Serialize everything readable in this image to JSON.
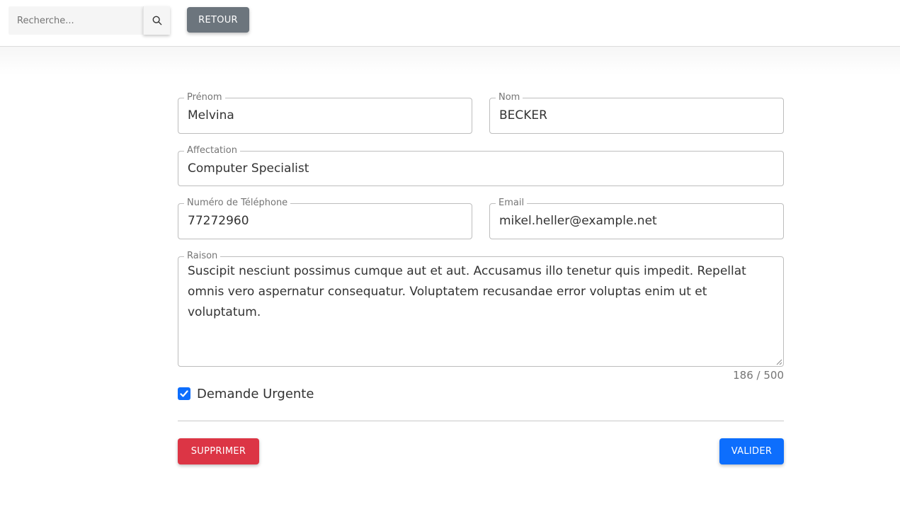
{
  "search": {
    "placeholder": "Recherche..."
  },
  "header": {
    "back_label": "RETOUR"
  },
  "form": {
    "first_name": {
      "label": "Prénom",
      "value": "Melvina"
    },
    "last_name": {
      "label": "Nom",
      "value": "BECKER"
    },
    "assignment": {
      "label": "Affectation",
      "value": "Computer Specialist"
    },
    "phone": {
      "label": "Numéro de Téléphone",
      "value": "77272960"
    },
    "email": {
      "label": "Email",
      "value": "mikel.heller@example.net"
    },
    "reason": {
      "label": "Raison",
      "value": "Suscipit nesciunt possimus cumque aut et aut. Accusamus illo tenetur quis impedit. Repellat omnis vero aspernatur consequatur. Voluptatem recusandae error voluptas enim ut et voluptatum.",
      "counter": "186 / 500"
    },
    "urgent": {
      "label": "Demande Urgente",
      "checked": true
    }
  },
  "actions": {
    "delete_label": "SUPPRIMER",
    "validate_label": "VALIDER"
  },
  "colors": {
    "primary": "#0d6efd",
    "danger": "#dc3545",
    "secondary": "#6c757d"
  },
  "icons": {
    "search": "search-icon",
    "check": "check-icon"
  }
}
